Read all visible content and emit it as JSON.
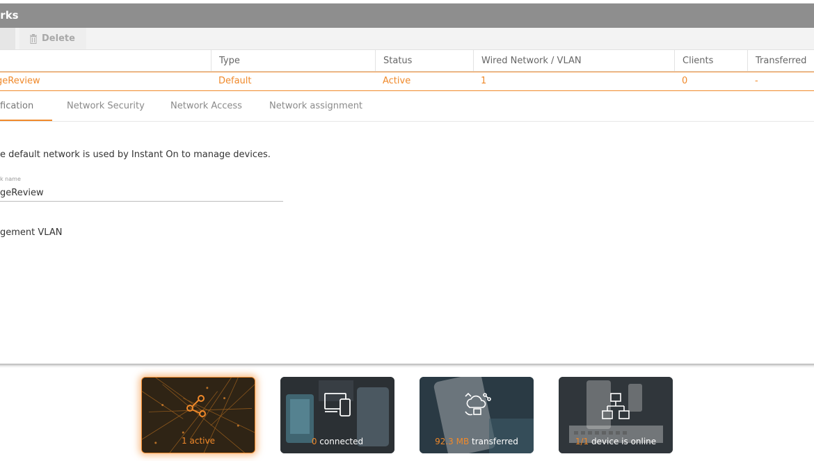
{
  "panel": {
    "title": "orks"
  },
  "toolbar": {
    "delete_label": "Delete"
  },
  "table": {
    "headers": [
      "Type",
      "Status",
      "Wired Network / VLAN",
      "Clients",
      "Transferred"
    ],
    "row": {
      "name": "geReview",
      "type": "Default",
      "status": "Active",
      "vlan": "1",
      "clients": "0",
      "transferred": "-"
    }
  },
  "tabs": [
    "fication",
    "Network Security",
    "Network Access",
    "Network assignment"
  ],
  "content": {
    "description": "e default network is used by Instant On to manage devices.",
    "field_label": "k name",
    "field_value": "geReview",
    "management_vlan": "gement VLAN"
  },
  "tiles": [
    {
      "num": "1",
      "suffix": " active"
    },
    {
      "num": "0",
      "suffix": " connected"
    },
    {
      "num": "92.3 MB",
      "suffix": " transferred"
    },
    {
      "num": "1/1",
      "suffix": " device is online"
    }
  ],
  "colors": {
    "accent": "#f0892a",
    "header_bg": "#8e8e8e",
    "tile_bg": "#2e3236"
  }
}
